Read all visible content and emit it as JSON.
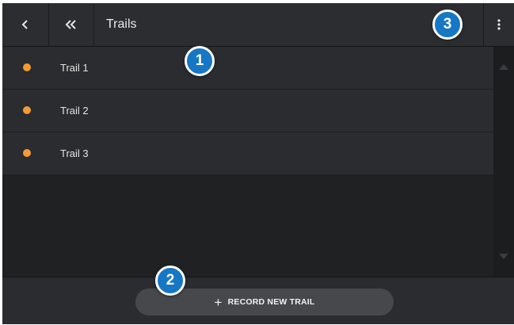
{
  "header": {
    "back_icon": "chevron-left-icon",
    "double_back_icon": "double-chevron-left-icon",
    "title": "Trails",
    "more_icon": "more-vertical-icon"
  },
  "trails": [
    {
      "name": "Trail 1",
      "color": "#f59a33"
    },
    {
      "name": "Trail 2",
      "color": "#f59a33"
    },
    {
      "name": "Trail 3",
      "color": "#f59a33"
    }
  ],
  "footer": {
    "record_label": "RECORD NEW TRAIL",
    "record_icon": "plus-icon"
  },
  "callouts": [
    "1",
    "2",
    "3"
  ],
  "colors": {
    "accent": "#1677c4",
    "trail_dot": "#f59a33"
  }
}
